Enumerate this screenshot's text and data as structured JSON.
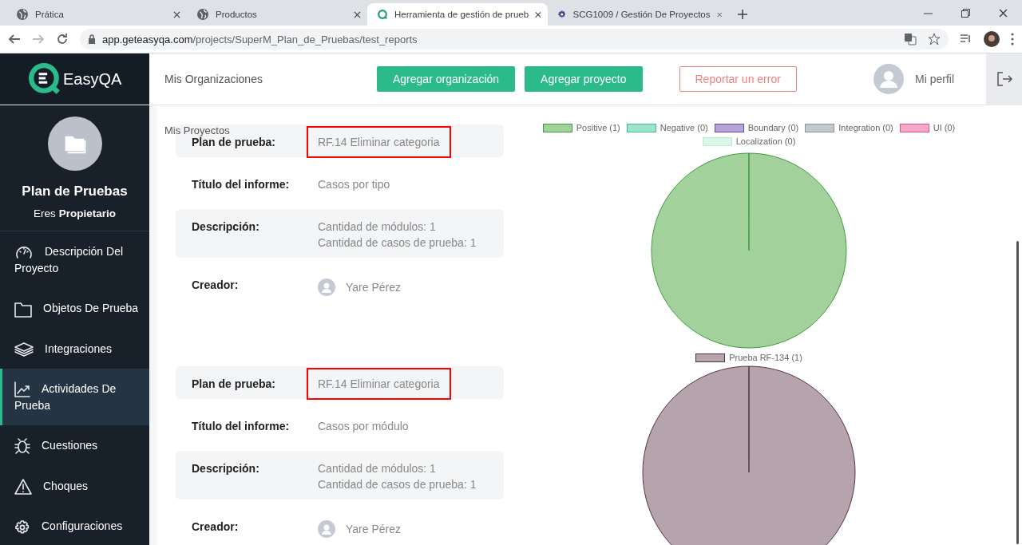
{
  "browser": {
    "tabs": [
      {
        "title": "Prática",
        "selected": false
      },
      {
        "title": "Productos",
        "selected": false
      },
      {
        "title": "Herramienta de gestión de prueb",
        "selected": true
      },
      {
        "title": "SCG1009 / Gestión De Proyectos",
        "selected": false
      }
    ],
    "url_host": "app.geteasyqa.com",
    "url_path": "/projects/SuperM_Plan_de_Pruebas/test_reports"
  },
  "header": {
    "logo": "EasyQA",
    "nav": "Mis Organizaciones",
    "buttons": [
      {
        "label": "Agregar organización",
        "kind": "primary"
      },
      {
        "label": "Agregar proyecto",
        "kind": "primary"
      },
      {
        "label": "Reportar un error",
        "kind": "outline"
      }
    ],
    "profile": "Mi perfil"
  },
  "sidebar": {
    "project": "Plan de Pruebas",
    "role": "Eres **Propietario**",
    "items": [
      {
        "label": "Descripción Del Proyecto",
        "selected": false
      },
      {
        "label": "Objetos De Prueba",
        "selected": false
      },
      {
        "label": "Integraciones",
        "selected": false
      },
      {
        "label": "Actividades De Prueba",
        "selected": true
      },
      {
        "label": "Cuestiones",
        "selected": false
      },
      {
        "label": "Choques",
        "selected": false
      },
      {
        "label": "Configuraciones",
        "selected": false
      }
    ]
  },
  "overlay_label": "Mis Proyectos",
  "reports": [
    {
      "fields": [
        {
          "label": "Plan de prueba:",
          "values": [
            "RF.14 Eliminar categoria"
          ],
          "highlighted": true
        },
        {
          "label": "Título del informe:",
          "values": [
            "Casos por tipo"
          ],
          "highlighted": false
        },
        {
          "label": "Descripción:",
          "values": [
            "Cantidad de módulos: 1",
            "Cantidad de casos de prueba: 1"
          ],
          "highlighted": false
        },
        {
          "label": "Creador:",
          "values": [
            "Yare Pérez"
          ],
          "kind": "user",
          "highlighted": false
        }
      ],
      "chart_data": {
        "type": "pie",
        "categories": [
          "Positive (1)",
          "Negative (0)",
          "Boundary (0)",
          "Integration (0)",
          "UI (0)",
          "Localization (0)"
        ],
        "values": [
          1,
          0,
          0,
          0,
          0,
          0
        ]
      }
    },
    {
      "fields": [
        {
          "label": "Plan de prueba:",
          "values": [
            "RF.14 Eliminar categoria"
          ],
          "highlighted": true
        },
        {
          "label": "Título del informe:",
          "values": [
            "Casos por módulo"
          ],
          "highlighted": false
        },
        {
          "label": "Descripción:",
          "values": [
            "Cantidad de módulos: 1",
            "Cantidad de casos de prueba: 1"
          ],
          "highlighted": false
        },
        {
          "label": "Creador:",
          "values": [
            "Yare Pérez"
          ],
          "kind": "user",
          "highlighted": false
        }
      ],
      "chart_data": {
        "type": "pie",
        "categories": [
          "Prueba RF-134 (1)"
        ],
        "values": [
          1
        ]
      }
    }
  ]
}
